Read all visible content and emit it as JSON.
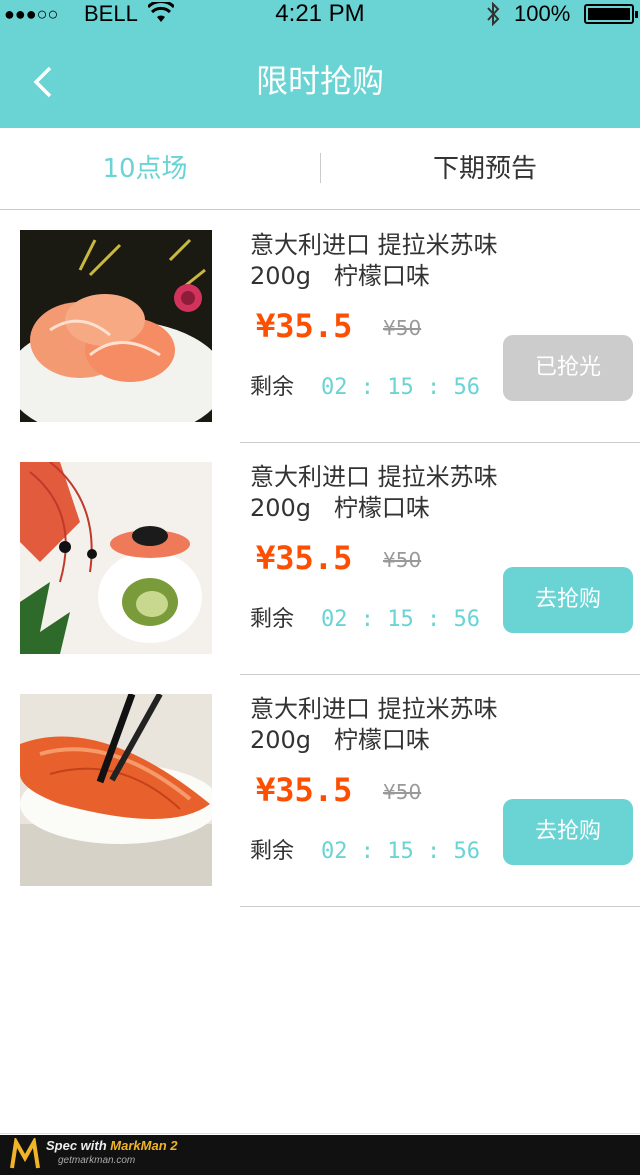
{
  "status_bar": {
    "signal": "●●●○○",
    "carrier": "BELL",
    "time": "4:21 PM",
    "battery": "100%"
  },
  "header": {
    "title": "限时抢购"
  },
  "tabs": {
    "current": "10点场",
    "next": "下期预告"
  },
  "products": [
    {
      "name_line1": "意大利进口 提拉米苏味",
      "name_line2": "200g   柠檬口味",
      "price": "¥35.5",
      "old_price": "¥50",
      "remain_label": "剩余",
      "countdown": "02 : 15 : 56",
      "button": "已抢光"
    },
    {
      "name_line1": "意大利进口 提拉米苏味",
      "name_line2": "200g   柠檬口味",
      "price": "¥35.5",
      "old_price": "¥50",
      "remain_label": "剩余",
      "countdown": "02 : 15 : 56",
      "button": "去抢购"
    },
    {
      "name_line1": "意大利进口 提拉米苏味",
      "name_line2": "200g   柠檬口味",
      "price": "¥35.5",
      "old_price": "¥50",
      "remain_label": "剩余",
      "countdown": "02 : 15 : 56",
      "button": "去抢购"
    }
  ],
  "footer": {
    "brand_prefix": "Spec with ",
    "brand_name": "MarkMan 2",
    "url": "getmarkman.com"
  },
  "colors": {
    "accent": "#6ad3d4",
    "price": "#fc4f01",
    "text": "#333333",
    "muted": "#999999",
    "disabled": "#cccccc",
    "header_text": "#ffffff"
  },
  "icons": {
    "back": "back-arrow-icon",
    "wifi": "wifi-icon",
    "bluetooth": "bluetooth-icon",
    "battery": "battery-icon"
  }
}
